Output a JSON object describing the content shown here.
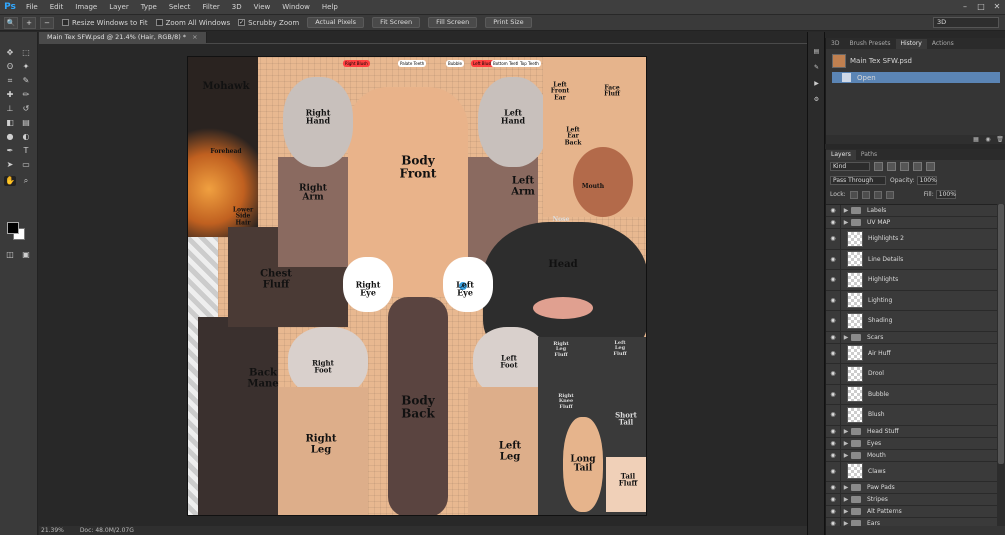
{
  "app": {
    "logo": "Ps"
  },
  "menu": [
    "File",
    "Edit",
    "Image",
    "Layer",
    "Type",
    "Select",
    "Filter",
    "3D",
    "View",
    "Window",
    "Help"
  ],
  "window_controls": [
    "–",
    "□",
    "✕"
  ],
  "options": {
    "resize_windows": "Resize Windows to Fit",
    "zoom_all": "Zoom All Windows",
    "scrubby": "Scrubby Zoom",
    "actual_pixels": "Actual Pixels",
    "fit_screen": "Fit Screen",
    "fill_screen": "Fill Screen",
    "print_size": "Print Size",
    "workspace": "3D"
  },
  "document": {
    "tab_title": "Main Tex SFW.psd @ 21.4% (Hair, RGB/8) *",
    "zoom": "21.39%",
    "doc_size": "Doc: 48.0M/2.07G"
  },
  "canvas_labels": {
    "mohawk": "Mohawk",
    "forehead": "Forehead",
    "right_hand": "Right\nHand",
    "body_front": "Body\nFront",
    "left_hand": "Left\nHand",
    "left_front_ear": "Left\nFront\nEar",
    "face_fluff": "Face\nFluff",
    "left_ear_back": "Left\nEar\nBack",
    "right_arm": "Right\nArm",
    "left_arm": "Left\nArm",
    "mouth": "Mouth",
    "nose": "Nose",
    "lower_side_hair": "Lower\nSide\nHair",
    "chest_fluff": "Chest\nFluff",
    "right_eye": "Right\nEye",
    "left_eye": "Left\nEye",
    "head": "Head",
    "back_mane": "Back\nMane",
    "right_foot": "Right\nFoot",
    "left_foot": "Left\nFoot",
    "right_leg_fluff": "Right\nLeg\nFluff",
    "left_leg_fluff": "Left\nLeg\nFluff",
    "body_back": "Body\nBack",
    "right_leg": "Right\nLeg",
    "left_leg": "Left\nLeg",
    "right_knee_fluff": "Right\nKnee\nFluff",
    "short_tail": "Short\nTail",
    "long_tail": "Long\nTail",
    "tail_fluff": "Tail\nFluff",
    "chip1": "Right Blush",
    "chip2": "Palate Teeth",
    "chip3": "Bubble",
    "chip4": "Left Blush",
    "chip5": "Bottom Teeth",
    "chip6": "Top Teeth"
  },
  "history": {
    "tabs": [
      "3D",
      "Brush Presets",
      "History",
      "Actions"
    ],
    "snapshot": "Main Tex SFW.psd",
    "states": [
      "Open"
    ]
  },
  "layers_panel": {
    "tabs": [
      "Layers",
      "Paths"
    ],
    "kind": "Kind",
    "blend_mode": "Pass Through",
    "opacity_label": "Opacity:",
    "opacity": "100%",
    "lock_label": "Lock:",
    "fill_label": "Fill:",
    "fill": "100%",
    "layers": [
      {
        "name": "Labels",
        "type": "group"
      },
      {
        "name": "UV MAP",
        "type": "group"
      },
      {
        "name": "Highlights 2",
        "type": "pixel"
      },
      {
        "name": "Line Details",
        "type": "pixel"
      },
      {
        "name": "Highlights",
        "type": "pixel"
      },
      {
        "name": "Lighting",
        "type": "pixel"
      },
      {
        "name": "Shading",
        "type": "pixel"
      },
      {
        "name": "Scars",
        "type": "group"
      },
      {
        "name": "Air Huff",
        "type": "pixel"
      },
      {
        "name": "Drool",
        "type": "pixel"
      },
      {
        "name": "Bubble",
        "type": "pixel"
      },
      {
        "name": "Blush",
        "type": "pixel"
      },
      {
        "name": "Head Stuff",
        "type": "group"
      },
      {
        "name": "Eyes",
        "type": "group"
      },
      {
        "name": "Mouth",
        "type": "group"
      },
      {
        "name": "Claws",
        "type": "pixel"
      },
      {
        "name": "Paw Pads",
        "type": "group"
      },
      {
        "name": "Stripes",
        "type": "group"
      },
      {
        "name": "Alt Patterns",
        "type": "group"
      },
      {
        "name": "Ears",
        "type": "group"
      }
    ]
  }
}
